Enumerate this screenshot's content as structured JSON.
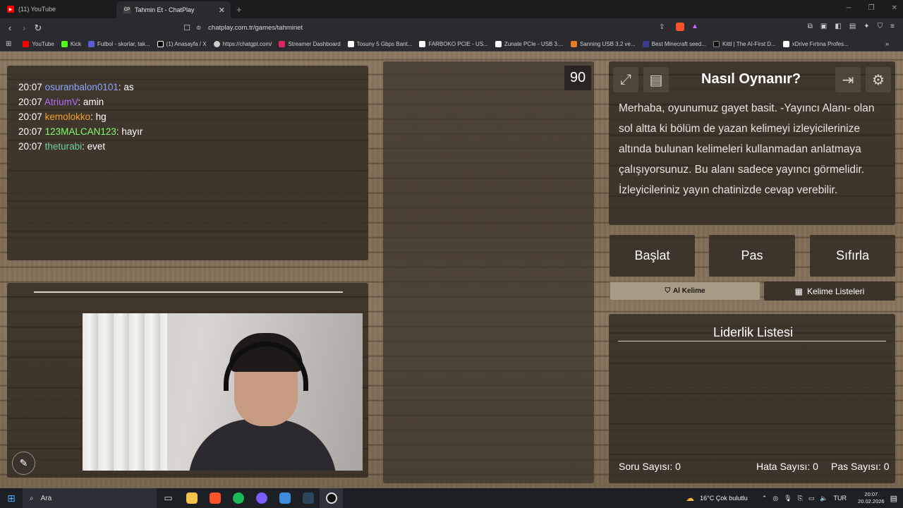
{
  "browser": {
    "tabs": [
      {
        "label": "(11) YouTube",
        "favicon_color": "#ff0000"
      },
      {
        "label": "Tahmin Et - ChatPlay",
        "favicon_text": "CP"
      }
    ],
    "close_glyph": "✕",
    "newtab_glyph": "+",
    "url": "chatplay.com.tr/games/tahminet",
    "bookmarks": [
      {
        "label": "YouTube",
        "color": "#ff0000"
      },
      {
        "label": "Kick",
        "color": "#53fc18"
      },
      {
        "label": "Futbol - skorlar, tak...",
        "color": "#5b5bd6"
      },
      {
        "label": "(1) Anasayfa / X",
        "color": "#ffffff"
      },
      {
        "label": "https://chatgpt.com/",
        "color": "#cccccc"
      },
      {
        "label": "Streamer Dashboard",
        "color": "#e0245e"
      },
      {
        "label": "Tosuny 5 Gbps Bant...",
        "color": "#ffffff"
      },
      {
        "label": "FARBOKO PCIE - US...",
        "color": "#ffffff"
      },
      {
        "label": "Zunate PCIe - USB 3....",
        "color": "#ffffff"
      },
      {
        "label": "Sanning USB 3.2 ve...",
        "color": "#e67e22"
      },
      {
        "label": "Best Minecraft seed...",
        "color": "#3b3b8f"
      },
      {
        "label": "Kittl | The AI-First D...",
        "color": "#111111"
      },
      {
        "label": "xDrive Fırtına Profes...",
        "color": "#ffffff"
      }
    ],
    "more_glyph": "»"
  },
  "chat": {
    "messages": [
      {
        "time": "20:07",
        "user": "osuranbalon0101",
        "user_color": "#8aa6ff",
        "text": ": as"
      },
      {
        "time": "20:07",
        "user": "AtriumV",
        "user_color": "#b06cff",
        "text": ": amin"
      },
      {
        "time": "20:07",
        "user": "kemolokko",
        "user_color": "#f0a030",
        "text": ": hg"
      },
      {
        "time": "20:07",
        "user": "123MALCAN123",
        "user_color": "#7dff6b",
        "text": ": hayır"
      },
      {
        "time": "20:07",
        "user": "theturabi",
        "user_color": "#6fd0a0",
        "text": ": evet"
      }
    ]
  },
  "game": {
    "timer": "90",
    "howto_title": "Nasıl Oynanır?",
    "howto_text": "Merhaba, oyunumuz gayet basit. -Yayıncı Alanı- olan sol altta ki bölüm de yazan kelimeyi izleyicilerinize altında bulunan kelimeleri kullanmadan anlatmaya çalışıyorsunuz. Bu alanı sadece yayıncı görmelidir. İzleyicileriniz yayın chatinizde cevap verebilir.",
    "buttons": {
      "start": "Başlat",
      "pass": "Pas",
      "reset": "Sıfırla",
      "ai_word": "Al Kelime",
      "word_lists": "Kelime Listeleri"
    },
    "leaderboard_title": "Liderlik Listesi",
    "stats": {
      "questions": "Soru Sayısı: 0",
      "errors": "Hata Sayısı: 0",
      "passes": "Pas Sayısı: 0"
    }
  },
  "taskbar": {
    "search_label": "Ara",
    "weather": "16°C  Çok bulutlu",
    "lang": "TUR",
    "time": "20:07",
    "date": "20.02.2026"
  }
}
